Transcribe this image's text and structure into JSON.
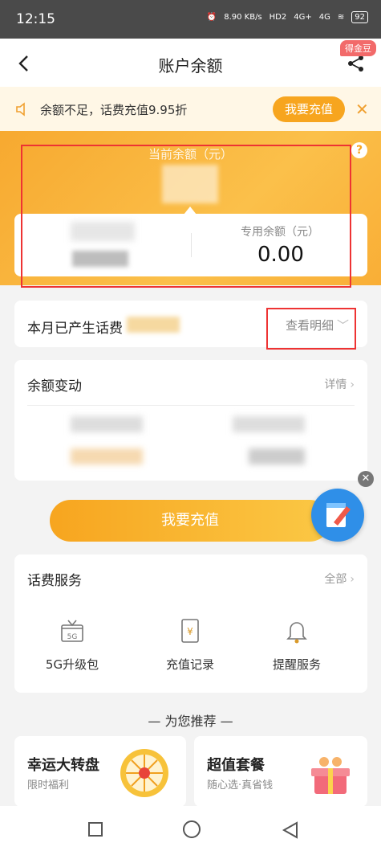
{
  "status": {
    "time": "12:15",
    "speed": "8.90 KB/s",
    "hd": "HD2",
    "net1": "4G+",
    "net2": "4G",
    "battery": "92"
  },
  "nav": {
    "title": "账户余额",
    "badge": "得金豆"
  },
  "notice": {
    "text": "余额不足，话费充值9.95折",
    "button": "我要充值",
    "close": "✕"
  },
  "hero": {
    "label": "当前余额（元）",
    "help": "?"
  },
  "balance": {
    "special_label": "专用余额（元）",
    "special_value": "0.00"
  },
  "month": {
    "text": "本月已产生话费",
    "link": "查看明细"
  },
  "changes": {
    "title": "余额变动",
    "link": "详情"
  },
  "recharge": {
    "button": "我要充值"
  },
  "services": {
    "title": "话费服务",
    "link": "全部",
    "items": [
      {
        "label": "5G升级包",
        "icon": "gift-5g-icon"
      },
      {
        "label": "充值记录",
        "icon": "receipt-yen-icon"
      },
      {
        "label": "提醒服务",
        "icon": "bell-icon"
      }
    ]
  },
  "recommend": {
    "title": "— 为您推荐 —"
  },
  "promos": [
    {
      "title": "幸运大转盘",
      "subtitle": "限时福利"
    },
    {
      "title": "超值套餐",
      "subtitle": "随心选·真省钱"
    }
  ],
  "colors": {
    "accent": "#f7a51f",
    "highlight_box": "#e33333"
  }
}
